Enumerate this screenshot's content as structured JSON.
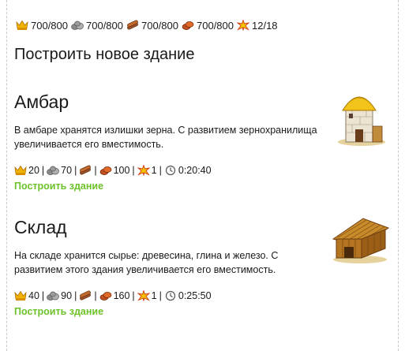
{
  "resources": [
    {
      "icon": "grain-icon",
      "value": "700/800"
    },
    {
      "icon": "stone-icon",
      "value": "700/800"
    },
    {
      "icon": "wood-icon",
      "value": "700/800"
    },
    {
      "icon": "clay-icon",
      "value": "700/800"
    },
    {
      "icon": "population-icon",
      "value": "12/18"
    }
  ],
  "page_title": "Построить новое здание",
  "buildings": [
    {
      "name": "Амбар",
      "image_icon": "granary-icon",
      "description": "В амбаре хранятся излишки зерна. С развитием зернохранилища увеличивается его вместимость.",
      "costs": {
        "grain": "20",
        "stone": "70",
        "wood": "",
        "clay": "100",
        "population": "1",
        "time": "0:20:40"
      },
      "build_label": "Построить здание"
    },
    {
      "name": "Склад",
      "image_icon": "warehouse-icon",
      "description": "На складе хранится сырье: древесина, глина и железо. С развитием этого здания увеличивается его вместимость.",
      "costs": {
        "grain": "40",
        "stone": "90",
        "wood": "",
        "clay": "160",
        "population": "1",
        "time": "0:25:50"
      },
      "build_label": "Построить здание"
    }
  ],
  "separator": "|",
  "colors": {
    "link": "#6dc22a",
    "crown": "#e8a800",
    "population": "#d23a1a"
  }
}
